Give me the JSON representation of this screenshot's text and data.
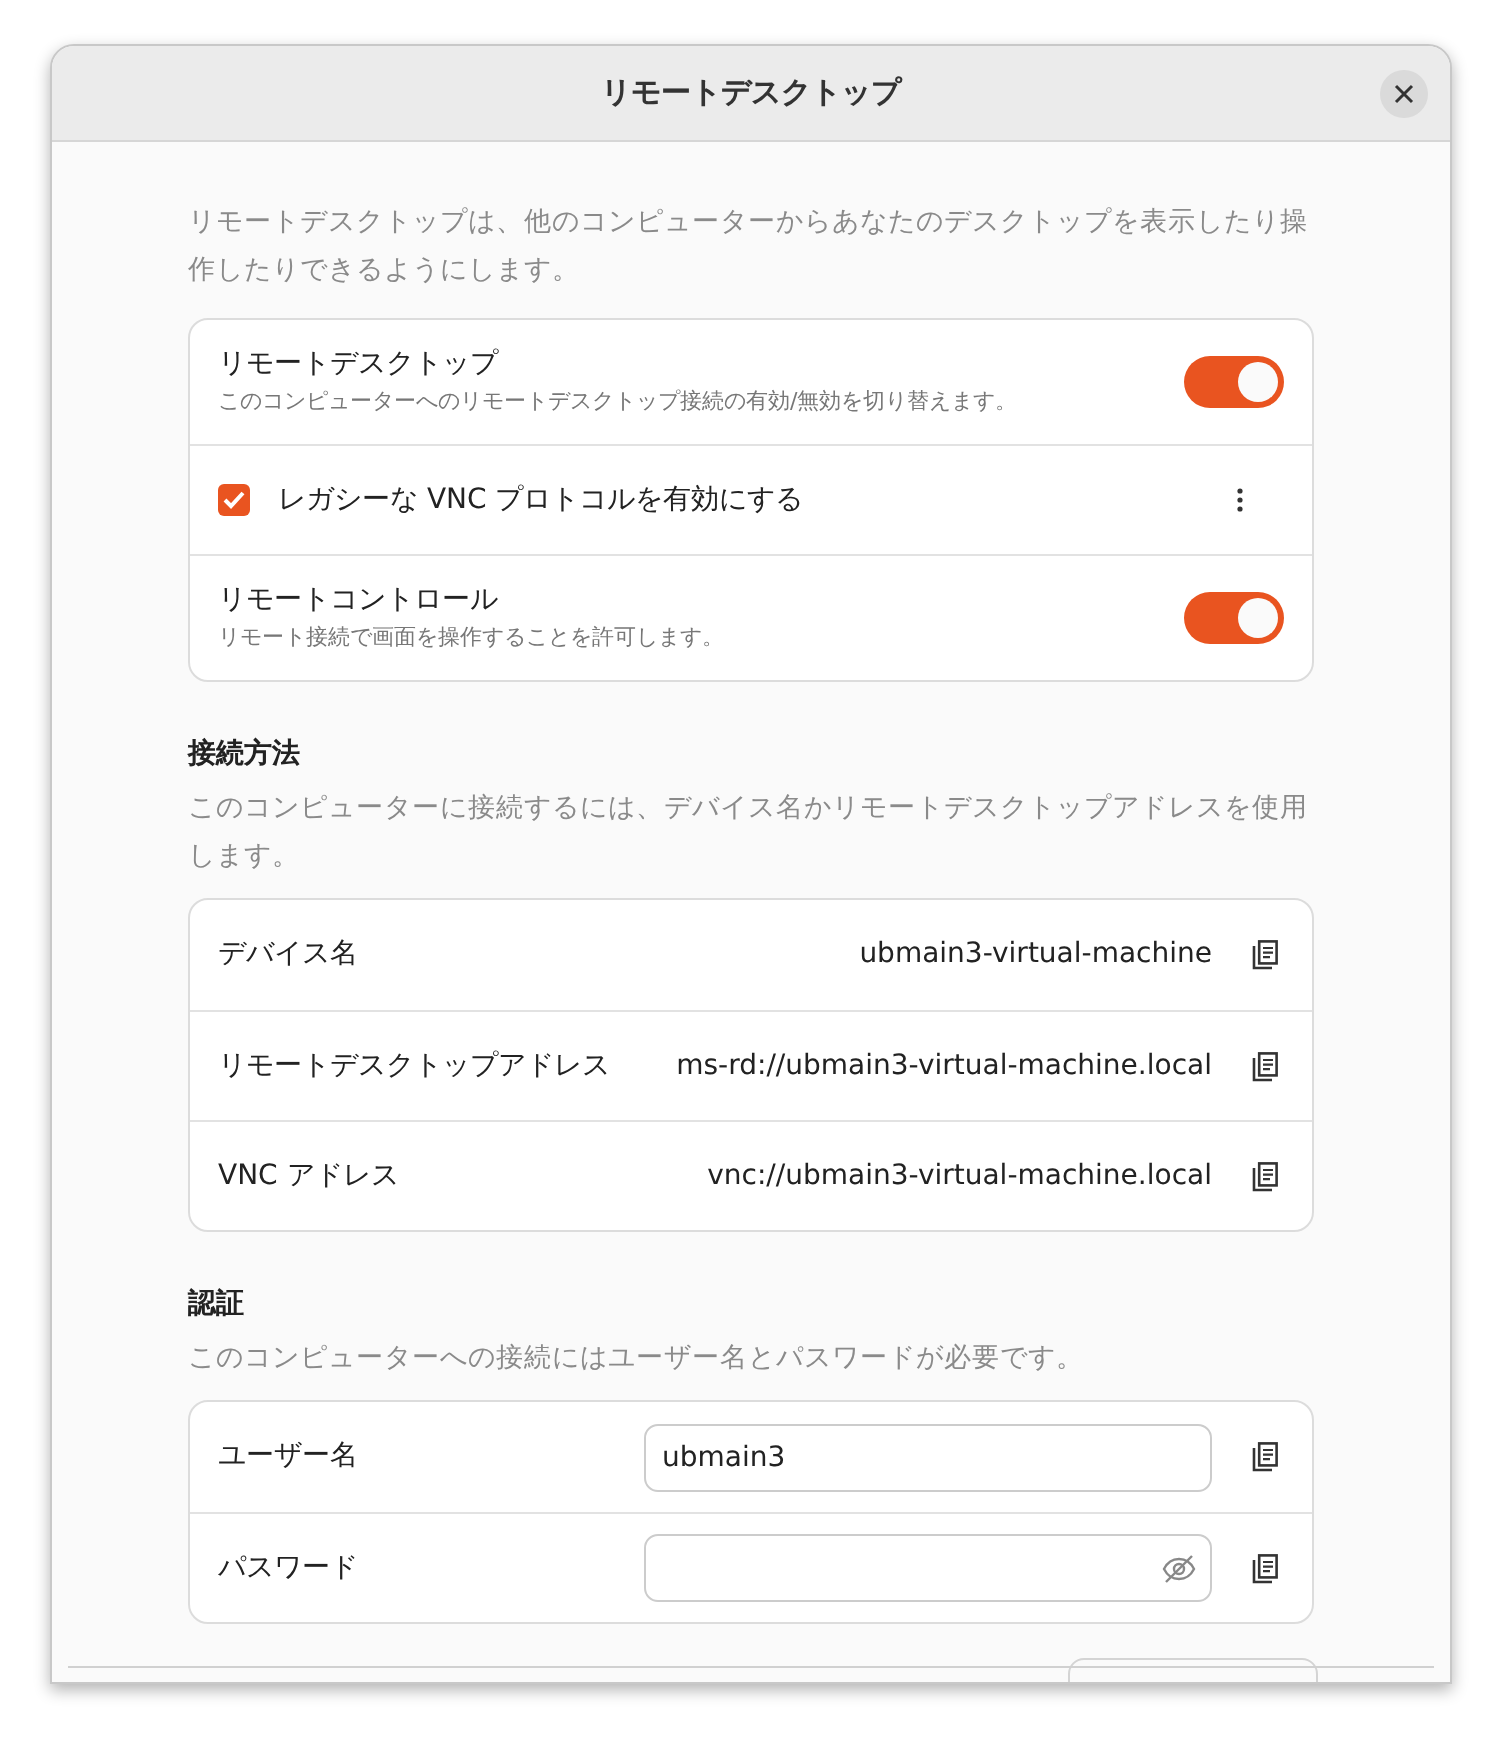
{
  "window": {
    "title": "リモートデスクトップ"
  },
  "intro": "リモートデスクトップは、他のコンピューターからあなたのデスクトップを表示したり操作したりできるようにします。",
  "settings": [
    {
      "kind": "toggle",
      "title": "リモートデスクトップ",
      "subtitle": "このコンピューターへのリモートデスクトップ接続の有効/無効を切り替えます。",
      "on": true
    },
    {
      "kind": "checkbox",
      "title": "レガシーな VNC プロトコルを有効にする",
      "checked": true
    },
    {
      "kind": "toggle",
      "title": "リモートコントロール",
      "subtitle": "リモート接続で画面を操作することを許可します。",
      "on": true
    }
  ],
  "connection": {
    "heading": "接続方法",
    "description": "このコンピューターに接続するには、デバイス名かリモートデスクトップアドレスを使用します。",
    "rows": [
      {
        "label": "デバイス名",
        "value": "ubmain3-virtual-machine"
      },
      {
        "label": "リモートデスクトップアドレス",
        "value": "ms-rd://ubmain3-virtual-machine.local"
      },
      {
        "label": "VNC アドレス",
        "value": "vnc://ubmain3-virtual-machine.local"
      }
    ]
  },
  "authentication": {
    "heading": "認証",
    "description": "このコンピューターへの接続にはユーザー名とパスワードが必要です。",
    "fields": [
      {
        "kind": "text",
        "label": "ユーザー名",
        "value": "ubmain3"
      },
      {
        "kind": "password",
        "label": "パスワード"
      }
    ]
  }
}
